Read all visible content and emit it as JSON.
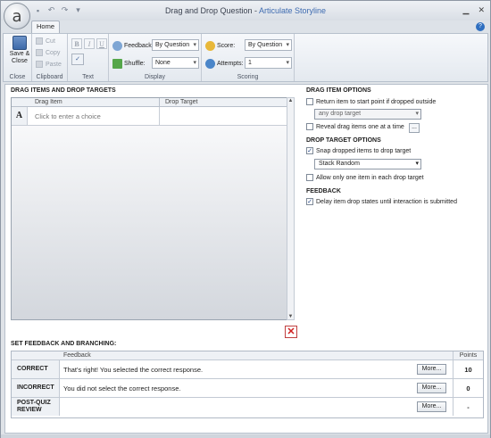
{
  "window": {
    "title_main": "Drag and Drop Question - ",
    "title_brand": "Articulate Storyline",
    "tab_home": "Home"
  },
  "ribbon": {
    "save_close": "Save & Close",
    "close_label": "Close",
    "cut": "Cut",
    "copy": "Copy",
    "paste": "Paste",
    "clipboard_label": "Clipboard",
    "text_label": "Text",
    "feedback_label": "Feedback:",
    "feedback_value": "By Question",
    "shuffle_label": "Shuffle:",
    "shuffle_value": "None",
    "display_label": "Display",
    "score_label": "Score:",
    "score_value": "By Question",
    "attempts_label": "Attempts:",
    "attempts_value": "1",
    "scoring_label": "Scoring"
  },
  "drag_section": {
    "title": "DRAG ITEMS AND DROP TARGETS",
    "col_drag_item": "Drag Item",
    "col_drop_target": "Drop Target",
    "rows": [
      {
        "letter": "A",
        "placeholder": "Click to enter a choice"
      }
    ]
  },
  "drag_item_options": {
    "title": "DRAG ITEM OPTIONS",
    "return_label": "Return item to start point if dropped outside",
    "return_checked": false,
    "return_target": "any drop target",
    "reveal_label": "Reveal drag items one at a time",
    "reveal_checked": false,
    "reveal_btn": "..."
  },
  "drop_target_options": {
    "title": "DROP TARGET OPTIONS",
    "snap_label": "Snap dropped items to drop target",
    "snap_checked": true,
    "snap_mode": "Stack Random",
    "allow_one_label": "Allow only one item in each drop target",
    "allow_one_checked": false
  },
  "feedback_options": {
    "title": "FEEDBACK",
    "delay_label": "Delay item drop states until interaction is submitted",
    "delay_checked": true
  },
  "feedback_section": {
    "title": "SET FEEDBACK AND BRANCHING:",
    "col_feedback": "Feedback",
    "col_points": "Points",
    "rows": [
      {
        "label": "CORRECT",
        "text": "That's right!  You selected the correct response.",
        "more": "More...",
        "points": "10"
      },
      {
        "label": "INCORRECT",
        "text": "You did not select the correct response.",
        "more": "More...",
        "points": "0"
      },
      {
        "label": "POST-QUIZ REVIEW",
        "text": "",
        "more": "More...",
        "points": "-"
      }
    ]
  }
}
